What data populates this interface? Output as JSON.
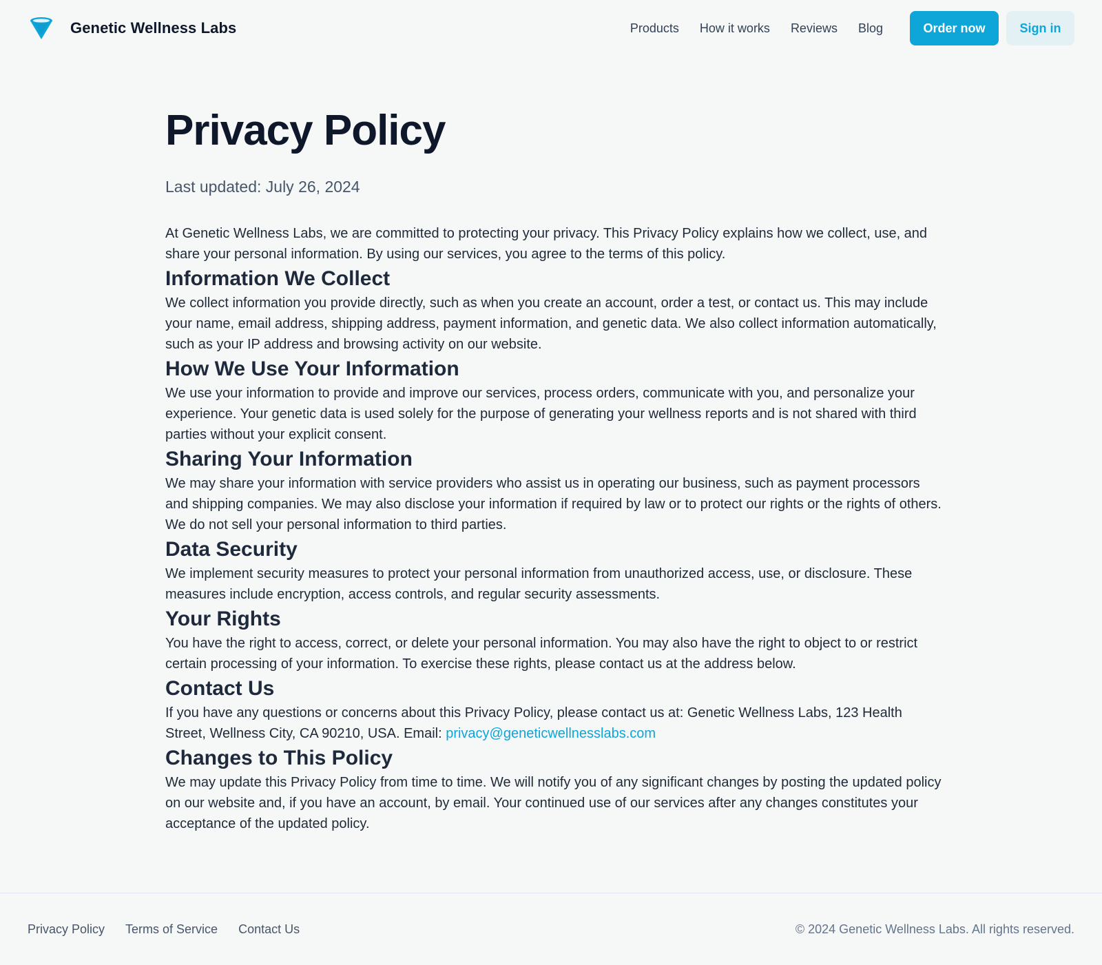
{
  "header": {
    "brand_name": "Genetic Wellness Labs",
    "logo_icon": "funnel-logo-icon",
    "nav": {
      "products": "Products",
      "how_it_works": "How it works",
      "reviews": "Reviews",
      "blog": "Blog"
    },
    "order_button": "Order now",
    "signin_button": "Sign in"
  },
  "main": {
    "title": "Privacy Policy",
    "last_updated": "Last updated: July 26, 2024",
    "intro": "At Genetic Wellness Labs, we are committed to protecting your privacy. This Privacy Policy explains how we collect, use, and share your personal information. By using our services, you agree to the terms of this policy.",
    "sections": [
      {
        "title": "Information We Collect",
        "body": "We collect information you provide directly, such as when you create an account, order a test, or contact us. This may include your name, email address, shipping address, payment information, and genetic data. We also collect information automatically, such as your IP address and browsing activity on our website."
      },
      {
        "title": "How We Use Your Information",
        "body": "We use your information to provide and improve our services, process orders, communicate with you, and personalize your experience. Your genetic data is used solely for the purpose of generating your wellness reports and is not shared with third parties without your explicit consent."
      },
      {
        "title": "Sharing Your Information",
        "body": "We may share your information with service providers who assist us in operating our business, such as payment processors and shipping companies. We may also disclose your information if required by law or to protect our rights or the rights of others. We do not sell your personal information to third parties."
      },
      {
        "title": "Data Security",
        "body": "We implement security measures to protect your personal information from unauthorized access, use, or disclosure. These measures include encryption, access controls, and regular security assessments."
      },
      {
        "title": "Your Rights",
        "body": "You have the right to access, correct, or delete your personal information. You may also have the right to object to or restrict certain processing of your information. To exercise these rights, please contact us at the address below."
      },
      {
        "title": "Contact Us",
        "body": "If you have any questions or concerns about this Privacy Policy, please contact us at: Genetic Wellness Labs, 123 Health Street, Wellness City, CA 90210, USA. Email: ",
        "email": "privacy@geneticwellnesslabs.com"
      },
      {
        "title": "Changes to This Policy",
        "body": "We may update this Privacy Policy from time to time. We will notify you of any significant changes by posting the updated policy on our website and, if you have an account, by email. Your continued use of our services after any changes constitutes your acceptance of the updated policy."
      }
    ]
  },
  "footer": {
    "links": {
      "privacy": "Privacy Policy",
      "terms": "Terms of Service",
      "contact": "Contact Us"
    },
    "copyright": "© 2024 Genetic Wellness Labs. All rights reserved."
  },
  "colors": {
    "accent": "#0ea5d9",
    "background": "#f6f8f8",
    "heading": "#0f172a"
  }
}
